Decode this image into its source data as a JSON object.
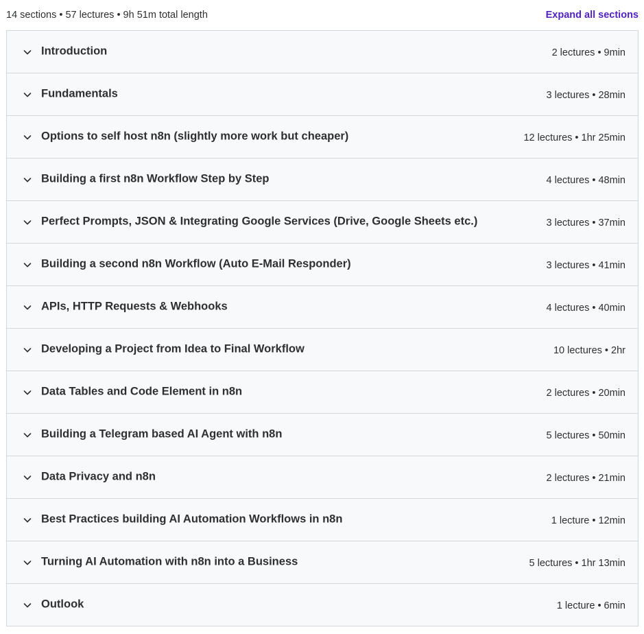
{
  "header": {
    "summary": "14 sections • 57 lectures • 9h 51m total length",
    "expand_label": "Expand all sections"
  },
  "colors": {
    "accent": "#5022c3",
    "row_background": "#f7f9fa",
    "border": "#d1d7dc",
    "text": "#2d2f31"
  },
  "icons": {
    "row_toggle": "chevron-down-icon"
  },
  "sections": [
    {
      "title": "Introduction",
      "meta": "2 lectures • 9min"
    },
    {
      "title": "Fundamentals",
      "meta": "3 lectures • 28min"
    },
    {
      "title": "Options to self host n8n (slightly more work but cheaper)",
      "meta": "12 lectures • 1hr 25min"
    },
    {
      "title": "Building a first n8n Workflow Step by Step",
      "meta": "4 lectures • 48min"
    },
    {
      "title": "Perfect Prompts, JSON & Integrating Google Services (Drive, Google Sheets etc.)",
      "meta": "3 lectures • 37min"
    },
    {
      "title": "Building a second n8n Workflow (Auto E-Mail Responder)",
      "meta": "3 lectures • 41min"
    },
    {
      "title": "APIs, HTTP Requests & Webhooks",
      "meta": "4 lectures • 40min"
    },
    {
      "title": "Developing a Project from Idea to Final Workflow",
      "meta": "10 lectures • 2hr"
    },
    {
      "title": "Data Tables and Code Element in n8n",
      "meta": "2 lectures • 20min"
    },
    {
      "title": "Building a Telegram based AI Agent with n8n",
      "meta": "5 lectures • 50min"
    },
    {
      "title": "Data Privacy and n8n",
      "meta": "2 lectures • 21min"
    },
    {
      "title": "Best Practices building AI Automation Workflows in n8n",
      "meta": "1 lecture • 12min"
    },
    {
      "title": "Turning AI Automation with n8n into a Business",
      "meta": "5 lectures • 1hr 13min"
    },
    {
      "title": "Outlook",
      "meta": "1 lecture • 6min"
    }
  ]
}
